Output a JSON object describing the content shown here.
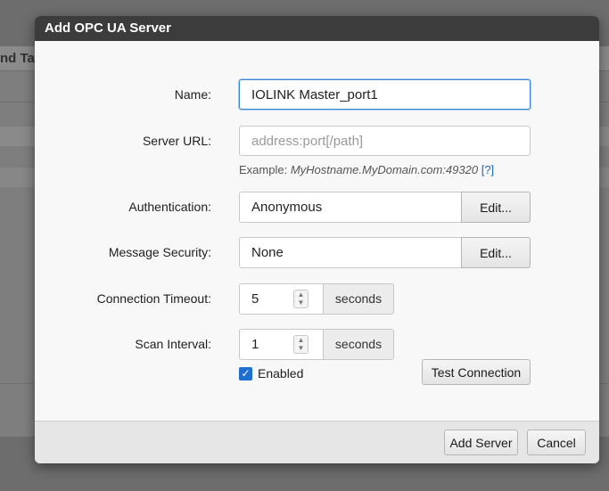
{
  "background": {
    "title": "nd Ta"
  },
  "dialog": {
    "title": "Add OPC UA Server",
    "name": {
      "label": "Name:",
      "value": "IOLINK Master_port1"
    },
    "server_url": {
      "label": "Server URL:",
      "placeholder": "address:port[/path]",
      "value": "",
      "example_prefix": "Example:",
      "example_value": "MyHostname.MyDomain.com:49320",
      "help": "[?]"
    },
    "authentication": {
      "label": "Authentication:",
      "value": "Anonymous",
      "edit": "Edit..."
    },
    "message_security": {
      "label": "Message Security:",
      "value": "None",
      "edit": "Edit..."
    },
    "connection_timeout": {
      "label": "Connection Timeout:",
      "value": "5",
      "unit": "seconds"
    },
    "scan_interval": {
      "label": "Scan Interval:",
      "value": "1",
      "unit": "seconds"
    },
    "enabled": {
      "label": "Enabled",
      "checked": true
    },
    "test_connection": "Test Connection",
    "add_server": "Add Server",
    "cancel": "Cancel"
  },
  "colors": {
    "titlebar": "#3c3c3c",
    "focus_border": "#3b86d1",
    "checkbox": "#1f6fd1",
    "link": "#1a66b8"
  }
}
